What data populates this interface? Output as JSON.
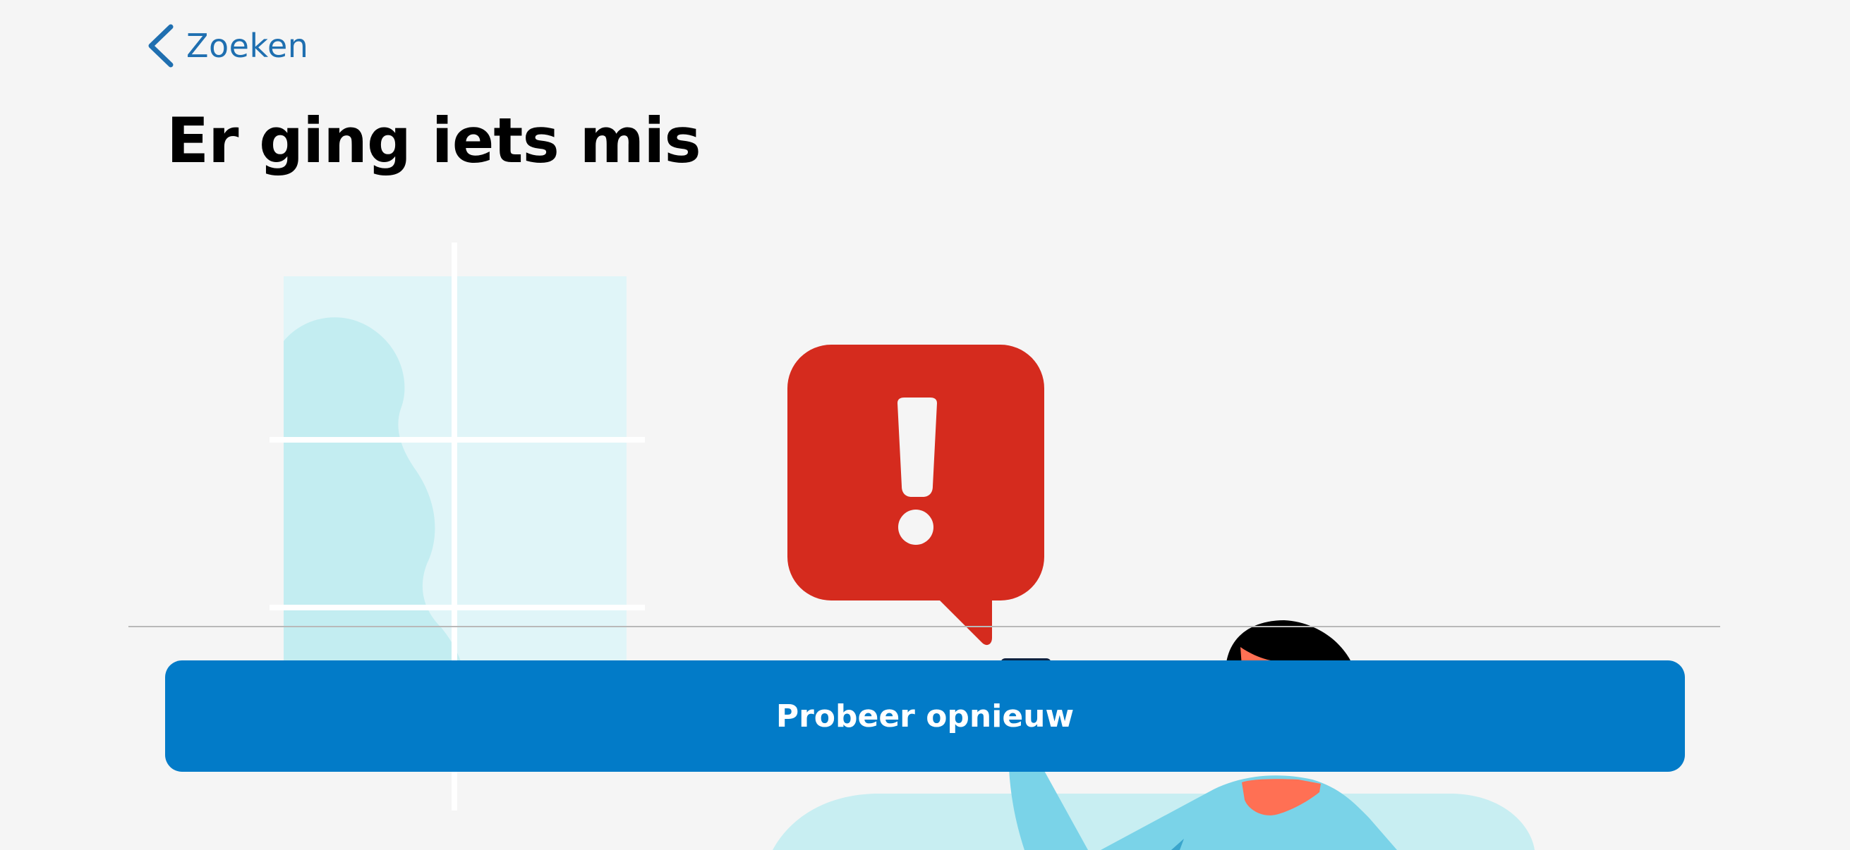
{
  "navigation": {
    "back_label": "Zoeken",
    "back_icon": "chevron-left-icon"
  },
  "page": {
    "title": "Er ging iets mis"
  },
  "illustration": {
    "alert_icon": "exclamation-speech-bubble-icon",
    "alert_color": "#d52b1e"
  },
  "actions": {
    "retry_label": "Probeer opnieuw"
  },
  "colors": {
    "background": "#f5f5f5",
    "accent": "#027bc8",
    "link": "#1f6fb0",
    "error": "#d52b1e"
  }
}
